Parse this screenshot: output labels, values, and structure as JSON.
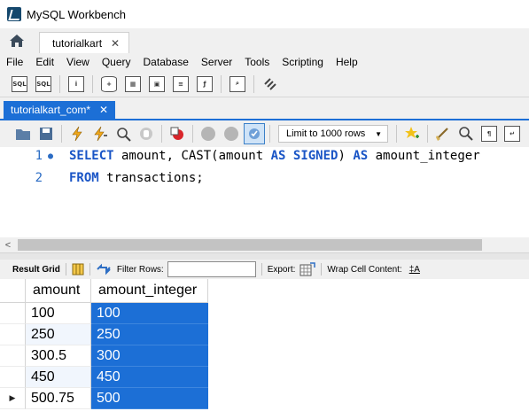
{
  "window": {
    "title": "MySQL Workbench"
  },
  "connection_tab": {
    "label": "tutorialkart",
    "close": "✕"
  },
  "menu": [
    "File",
    "Edit",
    "View",
    "Query",
    "Database",
    "Server",
    "Tools",
    "Scripting",
    "Help"
  ],
  "query_tab": {
    "label": "tutorialkart_com*",
    "close": "✕"
  },
  "editor_toolbar": {
    "limit_label": "Limit to 1000 rows"
  },
  "editor": {
    "lines": [
      {
        "number": "1",
        "marker": "●"
      },
      {
        "number": "2",
        "marker": ""
      }
    ],
    "line1": {
      "select": "SELECT",
      "amount": " amount, ",
      "cast": "CAST",
      "paren": "(amount ",
      "as1": "AS",
      "space": " ",
      "signed": "SIGNED",
      "close": ") ",
      "as2": "AS",
      "alias": " amount_integer"
    },
    "line2": {
      "from": "FROM",
      "rest": " transactions;"
    }
  },
  "result_toolbar": {
    "result_grid": "Result Grid",
    "filter_rows": "Filter Rows:",
    "export": "Export:",
    "wrap": "Wrap Cell Content:"
  },
  "grid": {
    "columns": [
      "amount",
      "amount_integer"
    ],
    "rows": [
      {
        "amount": "100",
        "amount_integer": "100"
      },
      {
        "amount": "250",
        "amount_integer": "250"
      },
      {
        "amount": "300.5",
        "amount_integer": "300"
      },
      {
        "amount": "450",
        "amount_integer": "450"
      },
      {
        "amount": "500.75",
        "amount_integer": "500"
      }
    ],
    "current_row_marker": "▶"
  },
  "colors": {
    "accent": "#1c6fd6",
    "keyword": "#1a55c6",
    "line_number": "#2b6cc4"
  }
}
